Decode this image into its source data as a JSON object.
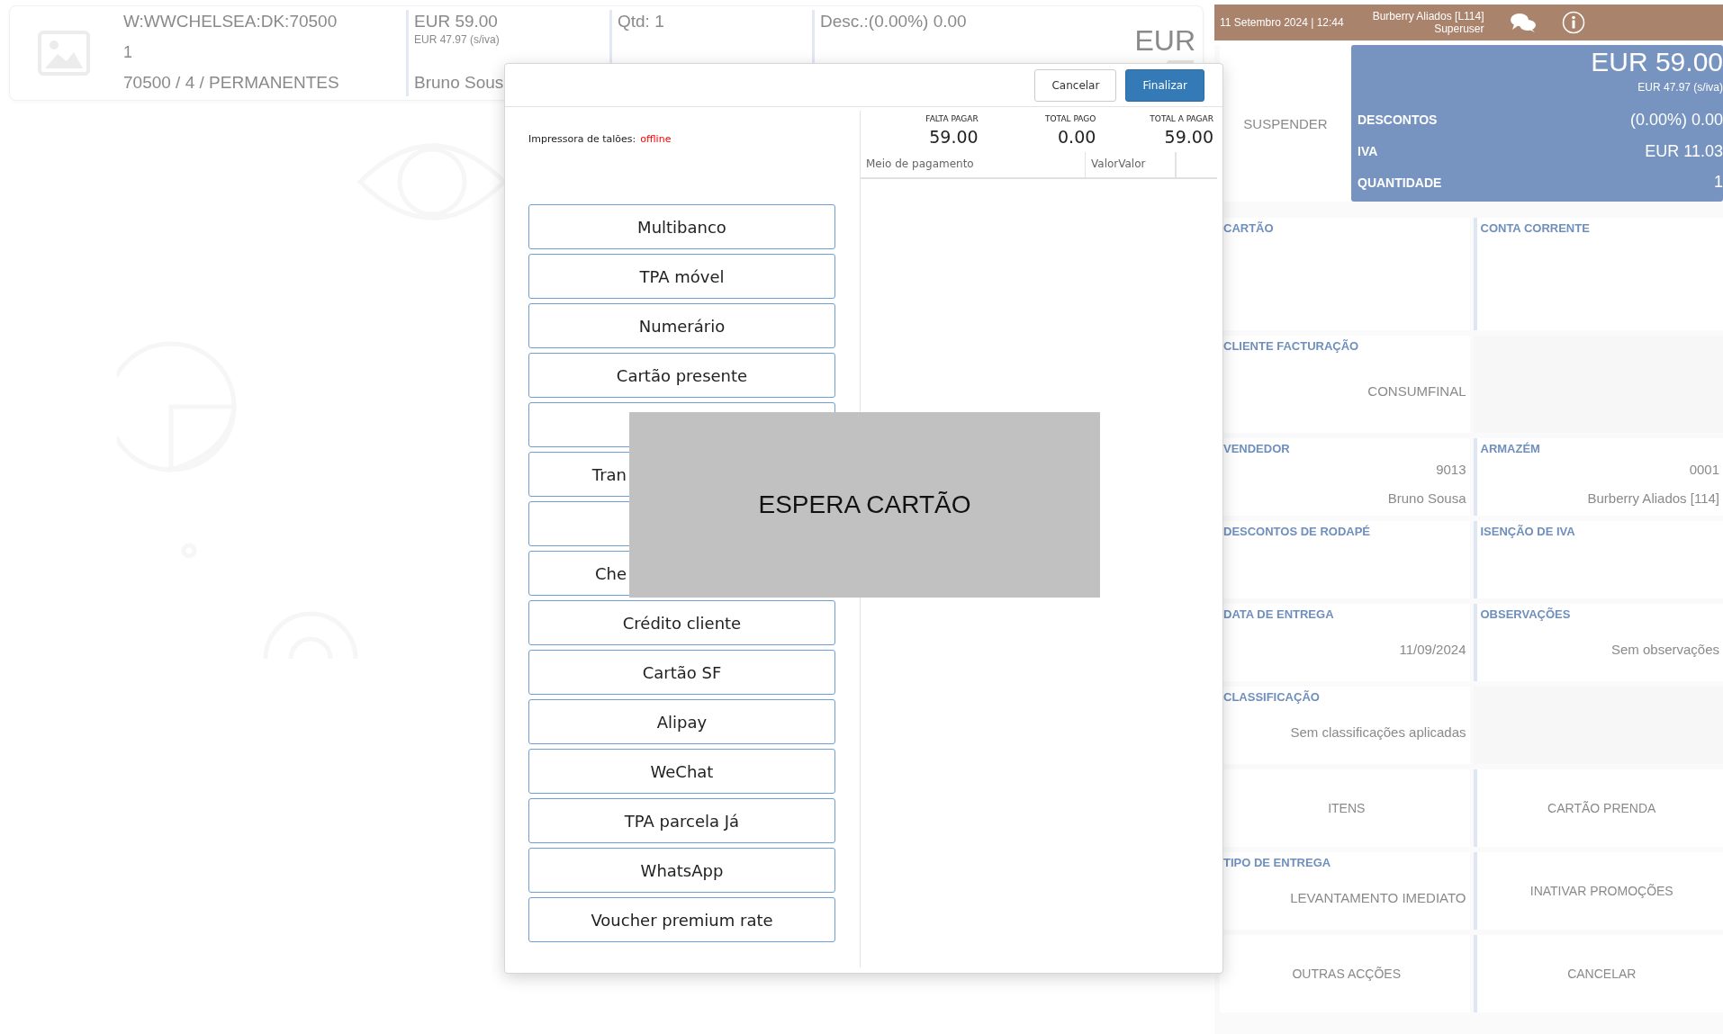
{
  "item_card": {
    "reference": "W:WWCHELSEA:DK:70500",
    "line": "1",
    "category": "70500 / 4 / PERMANENTES",
    "price": "EUR 59.00",
    "price_net": "EUR 47.97 (s/iva)",
    "seller": "Bruno Sous",
    "quantity": "Qtd: 1",
    "discount": "Desc.:(0.00%) 0.00",
    "currency": "EUR"
  },
  "session_bar": {
    "datetime": "11 Setembro 2024 | 12:44",
    "store": "Burberry Aliados [L114]",
    "user": "Superuser"
  },
  "summary": {
    "action": "SUSPENDER",
    "total": "EUR 59.00",
    "total_net": "EUR 47.97 (s/iva)",
    "rows": [
      {
        "label": "DESCONTOS",
        "value": "(0.00%) 0.00"
      },
      {
        "label": "IVA",
        "value": "EUR 11.03"
      },
      {
        "label": "QUANTIDADE",
        "value": "1"
      }
    ]
  },
  "panel_rows": [
    {
      "cells": [
        {
          "kind": "info",
          "label": "CARTÃO"
        },
        {
          "kind": "info",
          "label": "CONTA CORRENTE"
        }
      ]
    },
    {
      "cells": [
        {
          "kind": "info",
          "label": "CLIENTE FACTURAÇÃO",
          "values": [
            "CONSUMFINAL"
          ]
        },
        {
          "kind": "blank"
        }
      ]
    },
    {
      "cells": [
        {
          "kind": "info",
          "label": "VENDEDOR",
          "values": [
            "9013",
            "Bruno Sousa"
          ]
        },
        {
          "kind": "info",
          "label": "ARMAZÉM",
          "values": [
            "0001",
            "Burberry Aliados [114]"
          ]
        }
      ]
    },
    {
      "cells": [
        {
          "kind": "info",
          "label": "DESCONTOS DE RODAPÉ"
        },
        {
          "kind": "info",
          "label": "ISENÇÃO DE IVA"
        }
      ]
    },
    {
      "cells": [
        {
          "kind": "info",
          "label": "DATA DE ENTREGA",
          "values": [
            "11/09/2024"
          ]
        },
        {
          "kind": "info",
          "label": "OBSERVAÇÕES",
          "values": [
            "Sem observações"
          ]
        }
      ]
    },
    {
      "cells": [
        {
          "kind": "info",
          "label": "CLASSIFICAÇÃO",
          "values": [
            "Sem classificações aplicadas"
          ]
        },
        {
          "kind": "blank"
        }
      ]
    },
    {
      "cells": [
        {
          "kind": "action",
          "label": "ITENS"
        },
        {
          "kind": "action",
          "label": "CARTÃO PRENDA"
        }
      ]
    },
    {
      "cells": [
        {
          "kind": "info",
          "label": "TIPO DE ENTREGA",
          "values": [
            "LEVANTAMENTO IMEDIATO"
          ]
        },
        {
          "kind": "action",
          "label": "INATIVAR PROMOÇÕES"
        }
      ]
    },
    {
      "cells": [
        {
          "kind": "action",
          "label": "OUTRAS ACÇÕES"
        },
        {
          "kind": "action",
          "label": "CANCELAR"
        }
      ]
    }
  ],
  "payment_dialog": {
    "buttons": [
      "Cancelar",
      "Finalizar"
    ],
    "printer": {
      "label": "Impressora de talões:",
      "status": "offline"
    },
    "methods": [
      {
        "kind": "full",
        "label": "Multibanco"
      },
      {
        "kind": "full",
        "label": "TPA móvel"
      },
      {
        "kind": "full",
        "label": "Numerário"
      },
      {
        "kind": "full",
        "label": "Cartão presente"
      },
      {
        "kind": "covered"
      },
      {
        "kind": "partial",
        "label": "Tran"
      },
      {
        "kind": "covered"
      },
      {
        "kind": "partial",
        "label": "Che"
      },
      {
        "kind": "full",
        "label": "Crédito cliente"
      },
      {
        "kind": "full",
        "label": "Cartão SF"
      },
      {
        "kind": "full",
        "label": "Alipay"
      },
      {
        "kind": "full",
        "label": "WeChat"
      },
      {
        "kind": "full",
        "label": "TPA parcela Já"
      },
      {
        "kind": "full",
        "label": "WhatsApp"
      },
      {
        "kind": "full",
        "label": "Voucher premium rate"
      }
    ],
    "totals": [
      {
        "label": "FALTA PAGAR",
        "value": "59.00"
      },
      {
        "label": "TOTAL PAGO",
        "value": "0.00"
      },
      {
        "label": "TOTAL A PAGAR",
        "value": "59.00"
      }
    ],
    "columns": [
      "Meio de pagamento",
      "ValorValor"
    ],
    "waiting": {
      "message": "ESPERA CARTÃO"
    }
  }
}
